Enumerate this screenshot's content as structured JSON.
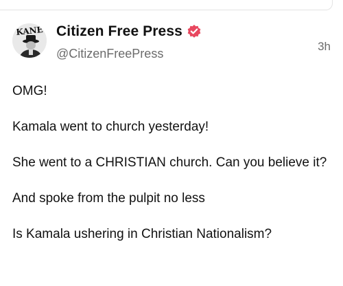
{
  "post": {
    "avatar_text": "KANE",
    "display_name": "Citizen Free Press",
    "handle": "@CitizenFreePress",
    "timestamp": "3h",
    "verified_color": "#e8485f",
    "paragraphs": [
      "OMG!",
      "Kamala went to church yesterday!",
      "She went to a CHRISTIAN church. Can you believe it?",
      "And spoke from the pulpit no less",
      "Is Kamala ushering in Christian Nationalism?"
    ]
  }
}
